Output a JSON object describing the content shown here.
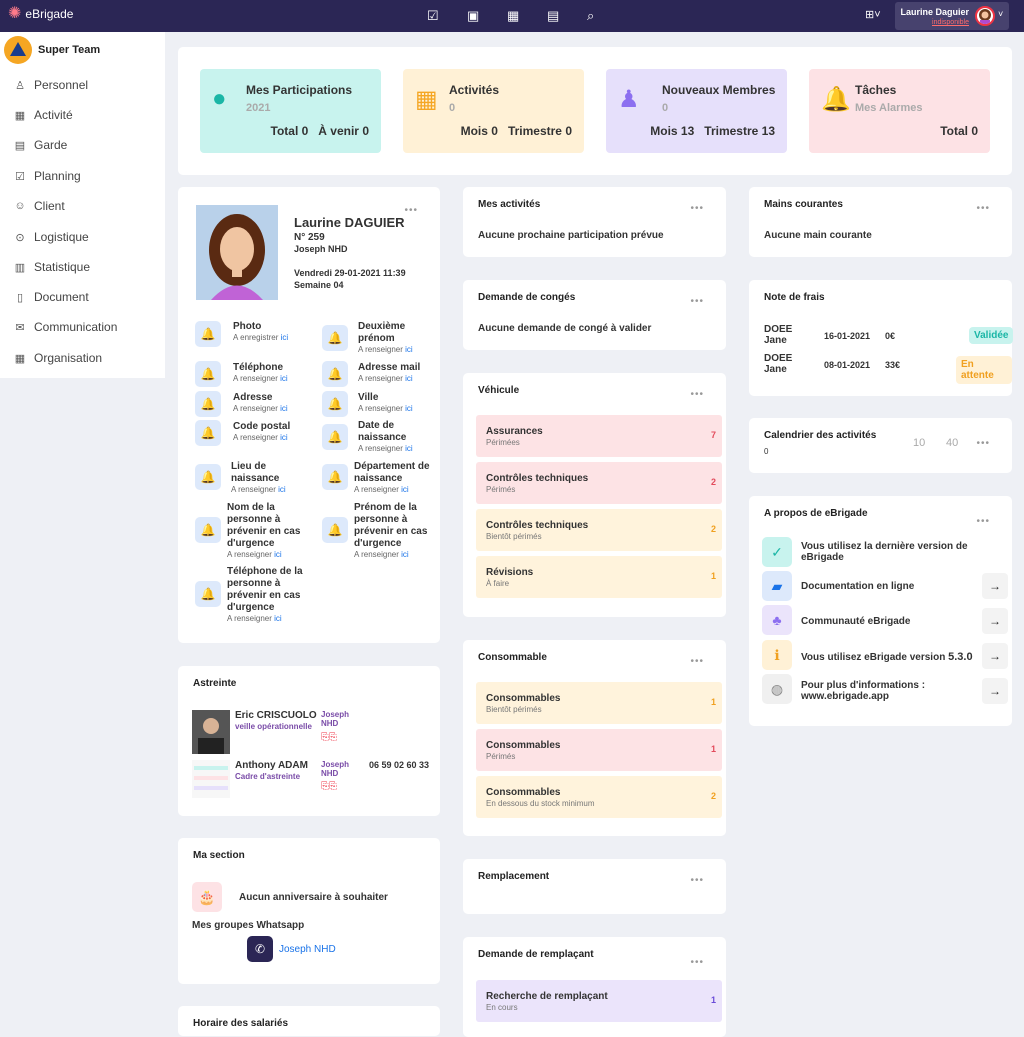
{
  "app": {
    "brand": "eBrigade",
    "user_name": "Laurine Daguier",
    "user_status": "indisponible"
  },
  "sidebar": {
    "team": "Super Team",
    "items": [
      {
        "label": "Personnel",
        "icon": "user-icon"
      },
      {
        "label": "Activité",
        "icon": "calendar-icon"
      },
      {
        "label": "Garde",
        "icon": "clipboard-icon"
      },
      {
        "label": "Planning",
        "icon": "calendar-check-icon"
      },
      {
        "label": "Client",
        "icon": "user-circle-icon"
      },
      {
        "label": "Logistique",
        "icon": "target-icon"
      },
      {
        "label": "Statistique",
        "icon": "chart-icon"
      },
      {
        "label": "Document",
        "icon": "file-icon"
      },
      {
        "label": "Communication",
        "icon": "mail-icon"
      },
      {
        "label": "Organisation",
        "icon": "building-icon"
      }
    ]
  },
  "stats": [
    {
      "title": "Mes Participations",
      "sub": "2021",
      "line": "Total 0   À venir 0",
      "color": "#c8f3ee",
      "icon_color": "#1bb6a6"
    },
    {
      "title": "Activités",
      "sub": "0",
      "line": "Mois 0   Trimestre 0",
      "color": "#fff1d6",
      "icon_color": "#f5a623"
    },
    {
      "title": "Nouveaux Membres",
      "sub": "0",
      "line": "Mois 13   Trimestre 13",
      "color": "#e6e0fb",
      "icon_color": "#8c6ff0"
    },
    {
      "title": "Tâches",
      "sub": "Mes Alarmes",
      "line": "Total 0",
      "color": "#fde2e5",
      "icon_color": "#f0404f"
    }
  ],
  "profile": {
    "name": "Laurine DAGUIER",
    "num": "N° 259",
    "section": "Joseph NHD",
    "date": "Vendredi 29-01-2021 11:39",
    "week": "Semaine 04",
    "fields": [
      {
        "label": "Photo",
        "hint": "A enregistrer",
        "link": "ici"
      },
      {
        "label": "Deuxième prénom",
        "hint": "A renseigner",
        "link": "ici"
      },
      {
        "label": "Téléphone",
        "hint": "A renseigner",
        "link": "ici"
      },
      {
        "label": "Adresse mail",
        "hint": "A renseigner",
        "link": "ici"
      },
      {
        "label": "Adresse",
        "hint": "A renseigner",
        "link": "ici"
      },
      {
        "label": "Ville",
        "hint": "A renseigner",
        "link": "ici"
      },
      {
        "label": "Code postal",
        "hint": "A renseigner",
        "link": "ici"
      },
      {
        "label": "Date de naissance",
        "hint": "A renseigner",
        "link": "ici"
      },
      {
        "label": "Lieu de naissance",
        "hint": "A renseigner",
        "link": "ici"
      },
      {
        "label": "Département de naissance",
        "hint": "A renseigner",
        "link": "ici"
      },
      {
        "label": "Nom de la personne à prévenir en cas d'urgence",
        "hint": "A renseigner",
        "link": "ici"
      },
      {
        "label": "Prénom de la personne à prévenir en cas d'urgence",
        "hint": "A renseigner",
        "link": "ici"
      },
      {
        "label": "Téléphone de la personne à prévenir en cas d'urgence",
        "hint": "A renseigner",
        "link": "ici"
      }
    ]
  },
  "astreinte": {
    "title": "Astreinte",
    "p1_name": "Eric CRISCUOLO",
    "p1_role": "veille opérationnelle",
    "p1_sec": "Joseph NHD",
    "p2_name": "Anthony ADAM",
    "p2_role": "Cadre d'astreinte",
    "p2_sec": "Joseph NHD",
    "p2_phone": "06 59 02 60 33"
  },
  "section": {
    "title": "Ma section",
    "birthday": "Aucun anniversaire à souhaiter",
    "wa_title": "Mes groupes Whatsapp",
    "wa_group": "Joseph NHD"
  },
  "horaire": {
    "title": "Horaire des salariés"
  },
  "mes_activites": {
    "title": "Mes activités",
    "text": "Aucune prochaine participation prévue"
  },
  "conges": {
    "title": "Demande de congés",
    "text": "Aucune demande de congé à valider"
  },
  "vehicule": {
    "title": "Véhicule",
    "rows": [
      {
        "a": "Assurances",
        "b": "Périmées",
        "c": "7"
      },
      {
        "a": "Contrôles techniques",
        "b": "Périmés",
        "c": "2"
      },
      {
        "a": "Contrôles techniques",
        "b": "Bientôt périmés",
        "c": "2"
      },
      {
        "a": "Révisions",
        "b": "À faire",
        "c": "1"
      }
    ]
  },
  "consommable": {
    "title": "Consommable",
    "rows": [
      {
        "a": "Consommables",
        "b": "Bientôt périmés",
        "c": "1"
      },
      {
        "a": "Consommables",
        "b": "Périmés",
        "c": "1"
      },
      {
        "a": "Consommables",
        "b": "En dessous du stock minimum",
        "c": "2"
      }
    ]
  },
  "remplacement": {
    "title": "Remplacement"
  },
  "remplacant": {
    "title": "Demande de remplaçant",
    "row": {
      "a": "Recherche de remplaçant",
      "b": "En cours",
      "c": "1"
    }
  },
  "mains": {
    "title": "Mains courantes",
    "text": "Aucune main courante"
  },
  "frais": {
    "title": "Note de frais",
    "rows": [
      {
        "name": "DOEE Jane",
        "date": "16-01-2021",
        "amount": "0€",
        "status": "Validée"
      },
      {
        "name": "DOEE Jane",
        "date": "08-01-2021",
        "amount": "33€",
        "status": "En attente"
      }
    ]
  },
  "calendrier": {
    "title": "Calendrier des activités",
    "v0": "0",
    "v10": "10",
    "v40": "40"
  },
  "apropos": {
    "title": "A propos de eBrigade",
    "items": [
      {
        "text": "Vous utilisez la dernière version de eBrigade"
      },
      {
        "text": "Documentation en ligne"
      },
      {
        "text": "Communauté eBrigade"
      },
      {
        "text": "Vous utilisez eBrigade version",
        "version": "5.3.0"
      },
      {
        "text": "Pour plus d'informations : www.ebrigade.app"
      }
    ]
  }
}
